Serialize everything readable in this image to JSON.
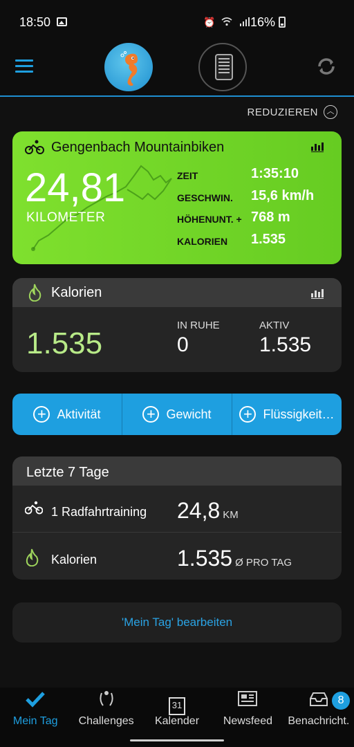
{
  "status_bar": {
    "time": "18:50",
    "battery": "16%",
    "icons": [
      "gallery-icon",
      "alarm-icon",
      "wifi-icon",
      "signal-icon",
      "battery-icon"
    ]
  },
  "header": {
    "menu_icon": "hamburger-menu-icon",
    "avatar_icon": "seahorse-avatar",
    "device_icon": "bike-computer-icon",
    "sync_icon": "sync-icon"
  },
  "reduce": {
    "label": "REDUZIEREN"
  },
  "activity": {
    "title": "Gengenbach Mountainbiken",
    "distance": "24,81",
    "distance_unit": "KILOMETER",
    "stats": [
      {
        "key": "ZEIT",
        "value": "1:35:10"
      },
      {
        "key": "GESCHWIN.",
        "value": "15,6 km/h"
      },
      {
        "key": "HÖHENUNT. +",
        "value": "768 m"
      },
      {
        "key": "KALORIEN",
        "value": "1.535"
      }
    ],
    "color": "#74d826"
  },
  "calories": {
    "title": "Kalorien",
    "total": "1.535",
    "rest_label": "IN RUHE",
    "rest_value": "0",
    "active_label": "AKTIV",
    "active_value": "1.535"
  },
  "quick_add": [
    {
      "label": "Aktivität"
    },
    {
      "label": "Gewicht"
    },
    {
      "label": "Flüssigkeit…"
    }
  ],
  "last7": {
    "title": "Letzte 7 Tage",
    "rows": [
      {
        "icon": "bike-icon",
        "label": "1 Radfahrtraining",
        "value": "24,8",
        "unit": "KM"
      },
      {
        "icon": "flame-icon",
        "label": "Kalorien",
        "value": "1.535",
        "unit": "Ø PRO TAG"
      }
    ]
  },
  "edit": {
    "label": "'Mein Tag' bearbeiten"
  },
  "bottom_nav": {
    "items": [
      {
        "label": "Mein Tag",
        "icon": "checkmark-icon"
      },
      {
        "label": "Challenges",
        "icon": "laurel-icon"
      },
      {
        "label": "Kalender",
        "icon": "calendar-icon",
        "day": "31"
      },
      {
        "label": "Newsfeed",
        "icon": "newspaper-icon"
      },
      {
        "label": "Benachricht.",
        "icon": "inbox-icon",
        "badge": "8"
      }
    ]
  },
  "colors": {
    "accent": "#1e9fe0",
    "activity_green": "#74d826",
    "calorie_green": "#b8ea88"
  }
}
